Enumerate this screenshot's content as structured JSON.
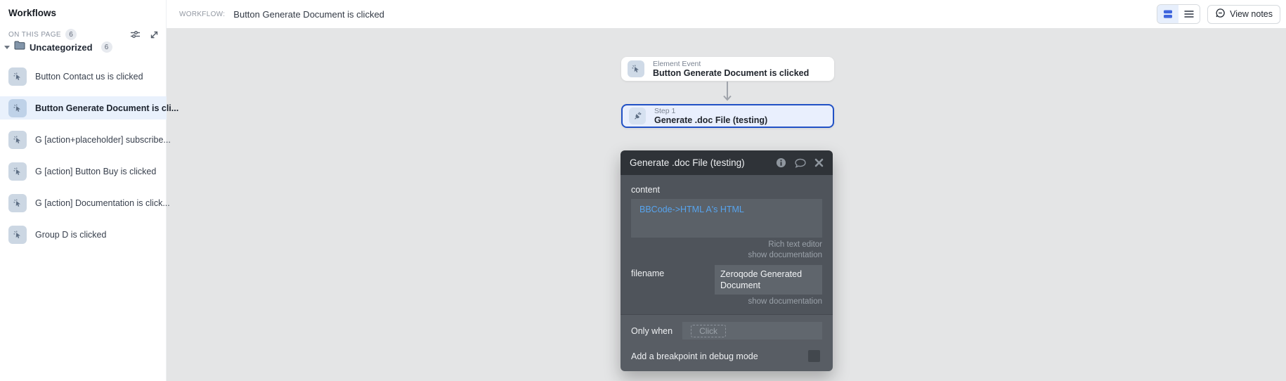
{
  "sidebar": {
    "title": "Workflows",
    "section_label": "ON THIS PAGE",
    "section_count": "6",
    "folder": {
      "name": "Uncategorized",
      "count": "6"
    },
    "items": [
      {
        "label": "Button Contact us is clicked",
        "selected": false
      },
      {
        "label": "Button Generate Document is cli...",
        "selected": true
      },
      {
        "label": "G [action+placeholder] subscribe...",
        "selected": false
      },
      {
        "label": "G [action] Button Buy is clicked",
        "selected": false
      },
      {
        "label": "G [action] Documentation is click...",
        "selected": false
      },
      {
        "label": "Group D is clicked",
        "selected": false
      }
    ]
  },
  "topbar": {
    "workflow_label": "WORKFLOW:",
    "workflow_title": "Button Generate Document is clicked",
    "view_notes_label": "View notes"
  },
  "canvas": {
    "event_card": {
      "type_label": "Element Event",
      "title": "Button Generate Document is clicked"
    },
    "step_card": {
      "type_label": "Step 1",
      "title": "Generate .doc File (testing)"
    }
  },
  "panel": {
    "title": "Generate .doc File (testing)",
    "fields": {
      "content_label": "content",
      "content_value": "BBCode->HTML A's HTML",
      "rich_text_editor_link": "Rich text editor",
      "show_documentation_link": "show documentation",
      "filename_label": "filename",
      "filename_value": "Zeroqode Generated Document",
      "filename_show_documentation_link": "show documentation",
      "only_when_label": "Only when",
      "only_when_placeholder": "Click",
      "breakpoint_label": "Add a breakpoint in debug mode"
    }
  },
  "icons": {
    "sidebar": [
      "sliders-icon",
      "expand-icon",
      "folder-icon",
      "click-icon"
    ],
    "topbar": [
      "cards-view-icon",
      "list-view-icon",
      "note-icon"
    ],
    "panel": [
      "info-icon",
      "comment-icon",
      "close-icon"
    ],
    "step": [
      "plug-icon"
    ]
  },
  "colors": {
    "canvas_bg": "#e4e5e6",
    "selection_bg": "#e9f1fc",
    "selected_card_border": "#2151c5",
    "selected_card_bg": "#e9effd",
    "panel_header_bg": "#2f3338",
    "panel_body_bg": "#4f545b",
    "expression_blue": "#57a4ee"
  }
}
